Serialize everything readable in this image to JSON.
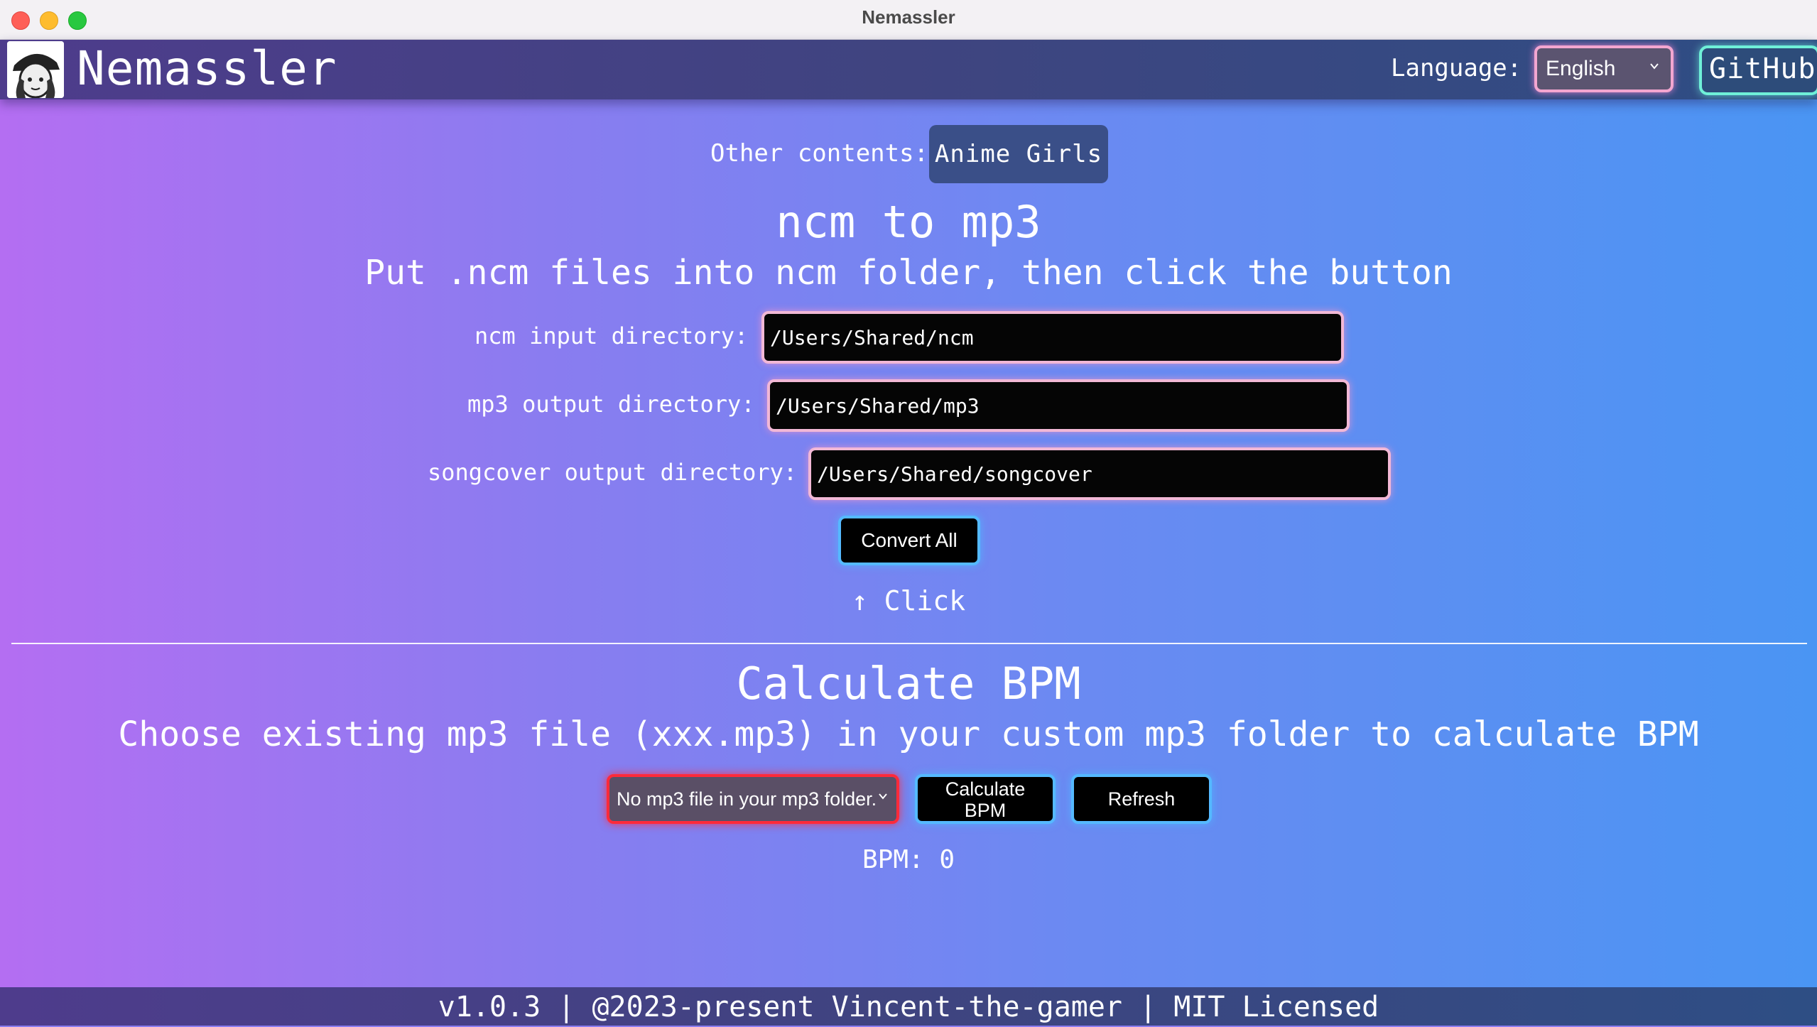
{
  "window": {
    "title": "Nemassler"
  },
  "header": {
    "app_name": "Nemassler",
    "language_label": "Language:",
    "language_value": "English",
    "github_label": "GitHub"
  },
  "other": {
    "label": "Other contents:",
    "button": "Anime Girls"
  },
  "convert": {
    "title": "ncm to mp3",
    "subtitle": "Put .ncm files into ncm folder, then click the button",
    "fields": [
      {
        "label": "ncm input directory:",
        "value": "/Users/Shared/ncm"
      },
      {
        "label": "mp3 output directory:",
        "value": "/Users/Shared/mp3"
      },
      {
        "label": "songcover output directory:",
        "value": "/Users/Shared/songcover"
      }
    ],
    "button": "Convert All",
    "hint": "↑ Click"
  },
  "bpm": {
    "title": "Calculate BPM",
    "subtitle": "Choose existing mp3 file (xxx.mp3) in your custom mp3 folder to calculate BPM",
    "select_value": "No mp3 file in your mp3 folder.",
    "calculate_label_line1": "Calculate",
    "calculate_label_line2": "BPM",
    "refresh_label": "Refresh",
    "result": "BPM: 0"
  },
  "footer": {
    "text": "v1.0.3 | @2023-present Vincent-the-gamer | MIT Licensed"
  },
  "colors": {
    "pink_border": "#f2b8d6",
    "blue_border": "#55b9ff",
    "red_border": "#ff2a3a",
    "teal_border": "#6ff0d8",
    "header_bg": "#3f4480"
  }
}
